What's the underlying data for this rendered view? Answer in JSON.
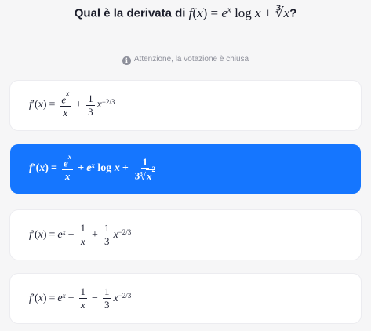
{
  "question": {
    "prefix": "Qual è la derivata di",
    "function": "f(x) = eˣ log x + ∛x",
    "suffix": "?"
  },
  "notice": {
    "icon": "info-icon",
    "text": "Attenzione, la votazione è chiusa"
  },
  "options": [
    {
      "label": "f′(x) = eˣ/x + 1/3 x^(−2/3)",
      "selected": false
    },
    {
      "label": "f′(x) = eˣ/x + eˣ log x + 1/(3∛x²)",
      "selected": true
    },
    {
      "label": "f′(x) = eˣ + 1/x + 1/3 x^(−2/3)",
      "selected": false
    },
    {
      "label": "f′(x) = eˣ + 1/x − 1/3 x^(−2/3)",
      "selected": false
    }
  ],
  "colors": {
    "selected": "#1576ff",
    "background": "#f6f6f7",
    "card": "#ffffff"
  }
}
